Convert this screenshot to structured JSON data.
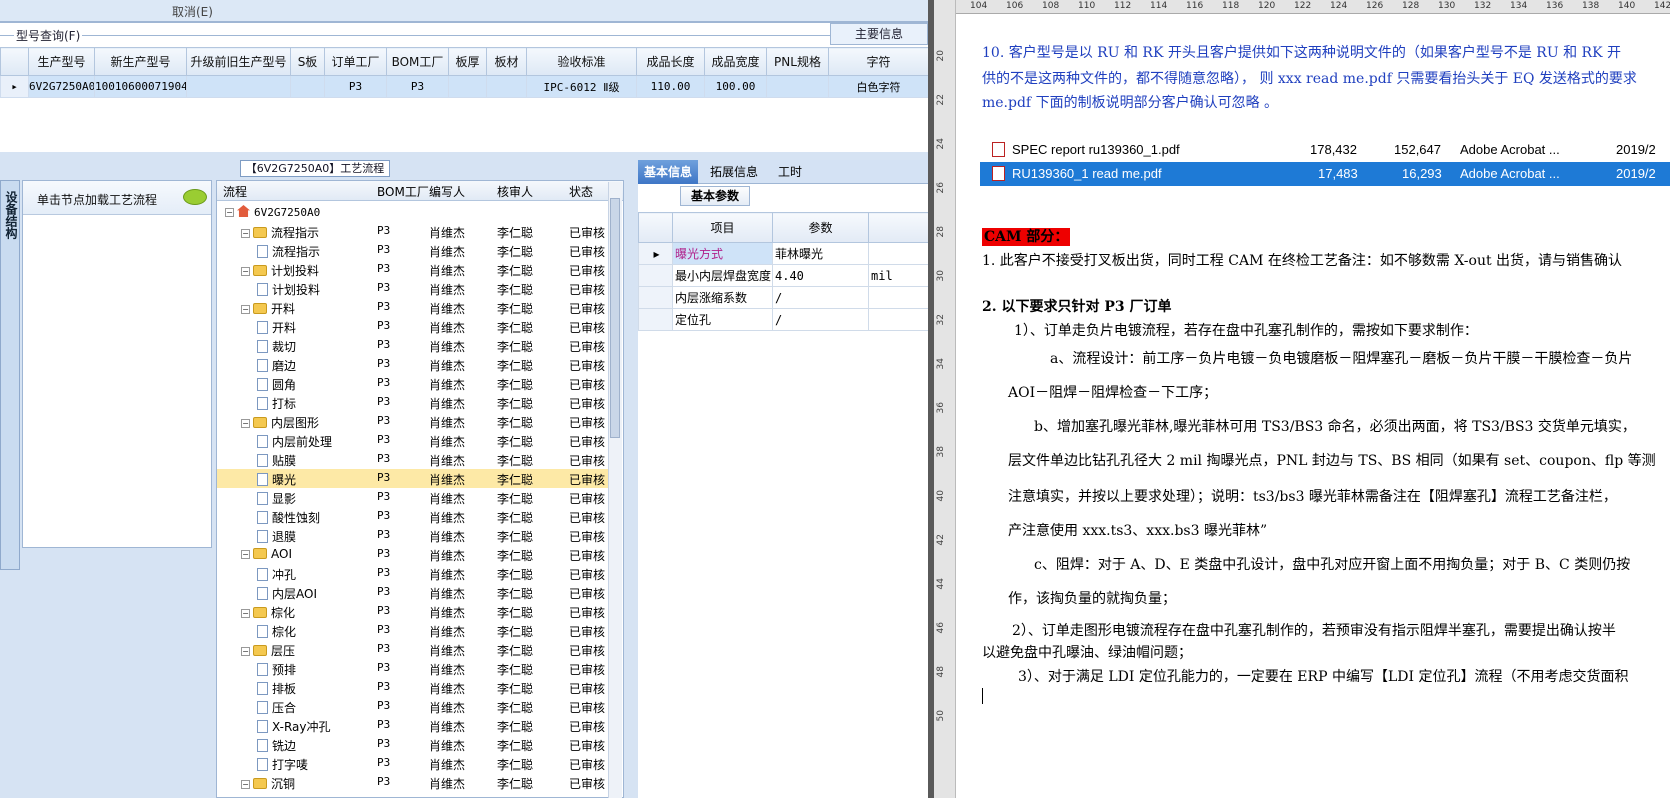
{
  "left_app": {
    "top_menu_text": "取消(E)",
    "query_section_label": "型号查询(F)",
    "main_panel_label": "主要信息",
    "grid": {
      "columns": [
        "生产型号",
        "新生产型号",
        "升级前旧生产型号",
        "S板",
        "订单工厂",
        "BOM工厂",
        "板厚",
        "板材",
        "验收标准",
        "成品长度",
        "成品宽度",
        "PNL规格",
        "字符"
      ],
      "row": [
        "6V2G7250A0",
        "10010600071904",
        "",
        "",
        "P3",
        "P3",
        "",
        "",
        "IPC-6012 Ⅱ级",
        "110.00",
        "100.00",
        "",
        "白色字符"
      ]
    },
    "flow_title": "【6V2G7250A0】工艺流程",
    "vertical_tab": "设备结构",
    "node_box_header": "单击节点加载工艺流程",
    "tree": {
      "columns": [
        "流程",
        "BOM工厂",
        "编写人",
        "核审人",
        "状态"
      ],
      "root": "6V2G7250A0",
      "rows": [
        {
          "name": "流程指示",
          "level": 1,
          "folder": true,
          "bom": "P3",
          "writer": "肖维杰",
          "reviewer": "李仁聪",
          "status": "已审核"
        },
        {
          "name": "流程指示",
          "level": 2,
          "folder": false,
          "bom": "P3",
          "writer": "肖维杰",
          "reviewer": "李仁聪",
          "status": "已审核"
        },
        {
          "name": "计划投料",
          "level": 1,
          "folder": true,
          "bom": "P3",
          "writer": "肖维杰",
          "reviewer": "李仁聪",
          "status": "已审核"
        },
        {
          "name": "计划投料",
          "level": 2,
          "folder": false,
          "bom": "P3",
          "writer": "肖维杰",
          "reviewer": "李仁聪",
          "status": "已审核"
        },
        {
          "name": "开料",
          "level": 1,
          "folder": true,
          "bom": "P3",
          "writer": "肖维杰",
          "reviewer": "李仁聪",
          "status": "已审核"
        },
        {
          "name": "开料",
          "level": 2,
          "folder": false,
          "bom": "P3",
          "writer": "肖维杰",
          "reviewer": "李仁聪",
          "status": "已审核"
        },
        {
          "name": "裁切",
          "level": 2,
          "folder": false,
          "bom": "P3",
          "writer": "肖维杰",
          "reviewer": "李仁聪",
          "status": "已审核"
        },
        {
          "name": "磨边",
          "level": 2,
          "folder": false,
          "bom": "P3",
          "writer": "肖维杰",
          "reviewer": "李仁聪",
          "status": "已审核"
        },
        {
          "name": "圆角",
          "level": 2,
          "folder": false,
          "bom": "P3",
          "writer": "肖维杰",
          "reviewer": "李仁聪",
          "status": "已审核"
        },
        {
          "name": "打标",
          "level": 2,
          "folder": false,
          "bom": "P3",
          "writer": "肖维杰",
          "reviewer": "李仁聪",
          "status": "已审核"
        },
        {
          "name": "内层图形",
          "level": 1,
          "folder": true,
          "bom": "P3",
          "writer": "肖维杰",
          "reviewer": "李仁聪",
          "status": "已审核"
        },
        {
          "name": "内层前处理",
          "level": 2,
          "folder": false,
          "bom": "P3",
          "writer": "肖维杰",
          "reviewer": "李仁聪",
          "status": "已审核"
        },
        {
          "name": "贴膜",
          "level": 2,
          "folder": false,
          "bom": "P3",
          "writer": "肖维杰",
          "reviewer": "李仁聪",
          "status": "已审核"
        },
        {
          "name": "曝光",
          "level": 2,
          "folder": false,
          "bom": "P3",
          "writer": "肖维杰",
          "reviewer": "李仁聪",
          "status": "已审核",
          "selected": true
        },
        {
          "name": "显影",
          "level": 2,
          "folder": false,
          "bom": "P3",
          "writer": "肖维杰",
          "reviewer": "李仁聪",
          "status": "已审核"
        },
        {
          "name": "酸性蚀刻",
          "level": 2,
          "folder": false,
          "bom": "P3",
          "writer": "肖维杰",
          "reviewer": "李仁聪",
          "status": "已审核"
        },
        {
          "name": "退膜",
          "level": 2,
          "folder": false,
          "bom": "P3",
          "writer": "肖维杰",
          "reviewer": "李仁聪",
          "status": "已审核"
        },
        {
          "name": "AOI",
          "level": 1,
          "folder": true,
          "bom": "P3",
          "writer": "肖维杰",
          "reviewer": "李仁聪",
          "status": "已审核"
        },
        {
          "name": "冲孔",
          "level": 2,
          "folder": false,
          "bom": "P3",
          "writer": "肖维杰",
          "reviewer": "李仁聪",
          "status": "已审核"
        },
        {
          "name": "内层AOI",
          "level": 2,
          "folder": false,
          "bom": "P3",
          "writer": "肖维杰",
          "reviewer": "李仁聪",
          "status": "已审核"
        },
        {
          "name": "棕化",
          "level": 1,
          "folder": true,
          "bom": "P3",
          "writer": "肖维杰",
          "reviewer": "李仁聪",
          "status": "已审核"
        },
        {
          "name": "棕化",
          "level": 2,
          "folder": false,
          "bom": "P3",
          "writer": "肖维杰",
          "reviewer": "李仁聪",
          "status": "已审核"
        },
        {
          "name": "层压",
          "level": 1,
          "folder": true,
          "bom": "P3",
          "writer": "肖维杰",
          "reviewer": "李仁聪",
          "status": "已审核"
        },
        {
          "name": "预排",
          "level": 2,
          "folder": false,
          "bom": "P3",
          "writer": "肖维杰",
          "reviewer": "李仁聪",
          "status": "已审核"
        },
        {
          "name": "排板",
          "level": 2,
          "folder": false,
          "bom": "P3",
          "writer": "肖维杰",
          "reviewer": "李仁聪",
          "status": "已审核"
        },
        {
          "name": "压合",
          "level": 2,
          "folder": false,
          "bom": "P3",
          "writer": "肖维杰",
          "reviewer": "李仁聪",
          "status": "已审核"
        },
        {
          "name": "X-Ray冲孔",
          "level": 2,
          "folder": false,
          "bom": "P3",
          "writer": "肖维杰",
          "reviewer": "李仁聪",
          "status": "已审核"
        },
        {
          "name": "铣边",
          "level": 2,
          "folder": false,
          "bom": "P3",
          "writer": "肖维杰",
          "reviewer": "李仁聪",
          "status": "已审核"
        },
        {
          "name": "打字唛",
          "level": 2,
          "folder": false,
          "bom": "P3",
          "writer": "肖维杰",
          "reviewer": "李仁聪",
          "status": "已审核"
        },
        {
          "name": "沉铜",
          "level": 1,
          "folder": true,
          "bom": "P3",
          "writer": "肖维杰",
          "reviewer": "李仁聪",
          "status": "已审核"
        }
      ]
    },
    "right_tabs": [
      "基本信息",
      "拓展信息",
      "工时"
    ],
    "params_header": "基本参数",
    "params_columns": [
      "项目",
      "参数"
    ],
    "params": [
      {
        "item": "曝光方式",
        "value": "菲林曝光",
        "unit": "",
        "highlight": true
      },
      {
        "item": "最小内层焊盘宽度",
        "value": "4.40",
        "unit": "mil"
      },
      {
        "item": "内层涨缩系数",
        "value": "/",
        "unit": ""
      },
      {
        "item": "定位孔",
        "value": "/",
        "unit": ""
      }
    ]
  },
  "doc": {
    "ruler_top": [
      "1",
      "4",
      "1",
      "2",
      "1",
      "4",
      "1",
      "6",
      "1",
      "8",
      "1",
      "10",
      "1",
      "12",
      "1",
      "14",
      "1",
      "16",
      "1",
      "18",
      "1",
      "20",
      "1",
      "22",
      "1",
      "24",
      "1",
      "26",
      "1",
      "28",
      "1",
      "30",
      "1",
      "32",
      "1",
      "34",
      "1",
      "36",
      "1",
      "38",
      "1",
      "40",
      "1",
      "42"
    ],
    "ruler_top_short": [
      "104",
      "106",
      "108",
      "110",
      "112",
      "114",
      "116",
      "118",
      "120",
      "122",
      "124",
      "126",
      "128",
      "130",
      "132",
      "134",
      "136",
      "138",
      "140",
      "142"
    ],
    "ruler_left": [
      "20",
      "22",
      "24",
      "26",
      "28",
      "30",
      "32",
      "34",
      "36",
      "38",
      "40",
      "42",
      "44",
      "46",
      "48",
      "50"
    ],
    "p10_line1": "10. 客户型号是以 RU 和 RK 开头且客户提供如下这两种说明文件的（如果客户型号不是 RU 和 RK 开",
    "p10_line2": "供的不是这两种文件的，都不得随意忽略）， 则 xxx read me.pdf  只需要看抬头关于 EQ 发送格式的要求",
    "p10_line3": "me.pdf 下面的制板说明部分客户确认可忽略 。",
    "files": [
      {
        "name": "SPEC report  ru139360_1.pdf",
        "size1": "178,432",
        "size2": "152,647",
        "app": "Adobe Acrobat ...",
        "date": "2019/2"
      },
      {
        "name": "RU139360_1 read me.pdf",
        "size1": "17,483",
        "size2": "16,293",
        "app": "Adobe Acrobat ...",
        "date": "2019/2",
        "selected": true
      }
    ],
    "cam_heading": "CAM 部分：",
    "l1": "1.    此客户不接受打叉板出货，同时工程 CAM 在终检工艺备注：如不够数需 X-out 出货，请与销售确认",
    "l2": "2.    以下要求只针对 P3 厂订单",
    "l3": "1）、订单走负片电镀流程，若存在盘中孔塞孔制作的，需按如下要求制作：",
    "l4": "a、流程设计：前工序－负片电镀－负电镀磨板－阻焊塞孔－磨板－负片干膜－干膜检查－负片",
    "l5": "AOI－阻焊－阻焊检查－下工序；",
    "l6": "b、增加塞孔曝光菲林,曝光菲林可用 TS3/BS3 命名，必须出两面，将 TS3/BS3 交货单元填实，",
    "l7": "层文件单边比钻孔孔径大 2 mil 掏曝光点，PNL 封边与 TS、BS 相同（如果有 set、coupon、flp 等测",
    "l8": "注意填实，并按以上要求处理）；说明：ts3/bs3 曝光菲林需备注在【阻焊塞孔】流程工艺备注栏，",
    "l9": "产注意使用 xxx.ts3、xxx.bs3 曝光菲林”",
    "l10": "c、阻焊：对于 A、D、E 类盘中孔设计，盘中孔对应开窗上面不用掏负量；对于 B、C 类则仍按",
    "l11": "作，该掏负量的就掏负量；",
    "l12": "2）、订单走图形电镀流程存在盘中孔塞孔制作的，若预审没有指示阻焊半塞孔，需要提出确认按半",
    "l13": "以避免盘中孔曝油、绿油帽问题；",
    "l14": "3）、对于满足 LDI 定位孔能力的，一定要在 ERP 中编写【LDI 定位孔】流程（不用考虑交货面积"
  }
}
